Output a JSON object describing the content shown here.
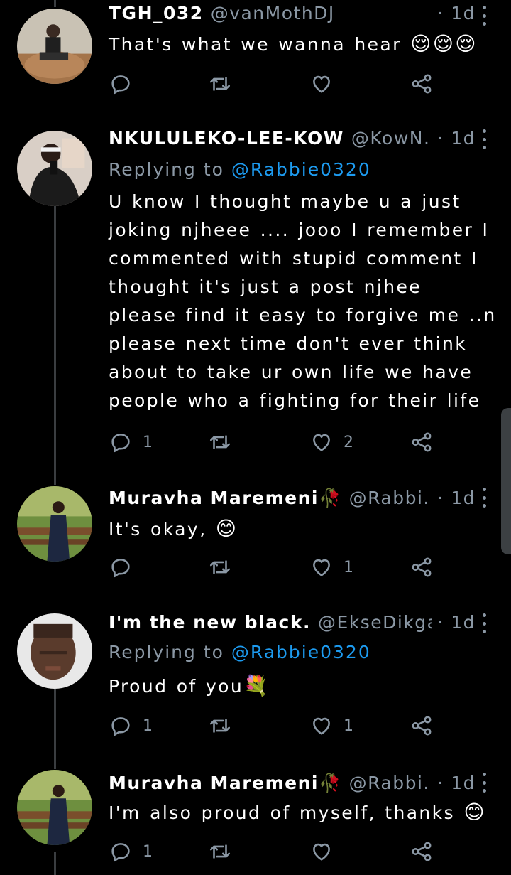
{
  "colors": {
    "background": "#000000",
    "text": "#ffffff",
    "muted": "#8b98a5",
    "mention": "#1d9bf0",
    "divider": "#2f3336"
  },
  "tweets": [
    {
      "name": "TGH_032",
      "handle": "@vanMothDJ",
      "time": "· 1d",
      "replying_label": "",
      "mention": "",
      "text": "That's what we wanna hear",
      "emoji": "😌😌😌",
      "counts": {
        "reply": "",
        "retweet": "",
        "like": ""
      }
    },
    {
      "name": "NKULULEKO-LEE-KOW",
      "handle": "@KowN...",
      "time": "· 1d",
      "replying_label": "Replying to",
      "mention": "@Rabbie0320",
      "text": "U know I thought maybe u a just joking njheee .... jooo I remember I commented with stupid comment I thought it's just a post njhee please find it easy to forgive me ..n please next time don't ever think about to take ur own life we have people who a fighting for their life",
      "emoji": "",
      "counts": {
        "reply": "1",
        "retweet": "",
        "like": "2"
      }
    },
    {
      "name": "Muravha Maremeni🥀",
      "handle": "@Rabbi...",
      "time": "· 1d",
      "replying_label": "",
      "mention": "",
      "text": "It's okay,",
      "emoji": "😊",
      "counts": {
        "reply": "",
        "retweet": "",
        "like": "1"
      }
    },
    {
      "name": "I'm the new black.",
      "handle": "@EkseDikga...",
      "time": "· 1d",
      "replying_label": "Replying to",
      "mention": "@Rabbie0320",
      "text": "Proud of you",
      "emoji": "💐",
      "counts": {
        "reply": "1",
        "retweet": "",
        "like": "1"
      }
    },
    {
      "name": "Muravha Maremeni🥀",
      "handle": "@Rabbi...",
      "time": "· 1d",
      "replying_label": "",
      "mention": "",
      "text": "I'm also proud of myself, thanks",
      "emoji": "😊",
      "counts": {
        "reply": "1",
        "retweet": "",
        "like": ""
      }
    }
  ],
  "icons": {
    "more": "more-vertical-icon",
    "reply": "reply-bubble-icon",
    "retweet": "retweet-icon",
    "like": "heart-icon",
    "share": "share-icon"
  }
}
